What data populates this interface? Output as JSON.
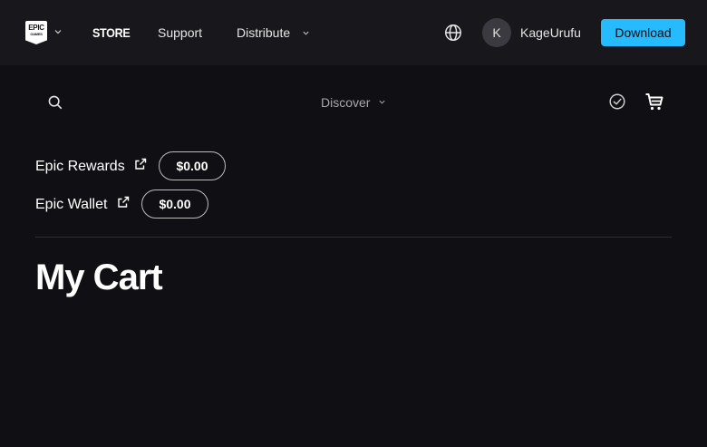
{
  "header": {
    "logo": {
      "line1": "EPIC",
      "line2": "GAMES"
    },
    "store_label": "STORE",
    "nav": [
      {
        "label": "Support"
      },
      {
        "label": "Distribute"
      }
    ],
    "user": {
      "initial": "K",
      "name": "KageUrufu"
    },
    "download_label": "Download",
    "accent_color": "#26bbff"
  },
  "subnav": {
    "discover_label": "Discover",
    "icons": [
      "search-icon",
      "chevron-down-icon",
      "check-circle-icon",
      "cart-icon"
    ]
  },
  "balances": [
    {
      "label": "Epic Rewards",
      "amount": "$0.00"
    },
    {
      "label": "Epic Wallet",
      "amount": "$0.00"
    }
  ],
  "page": {
    "title": "My Cart"
  }
}
